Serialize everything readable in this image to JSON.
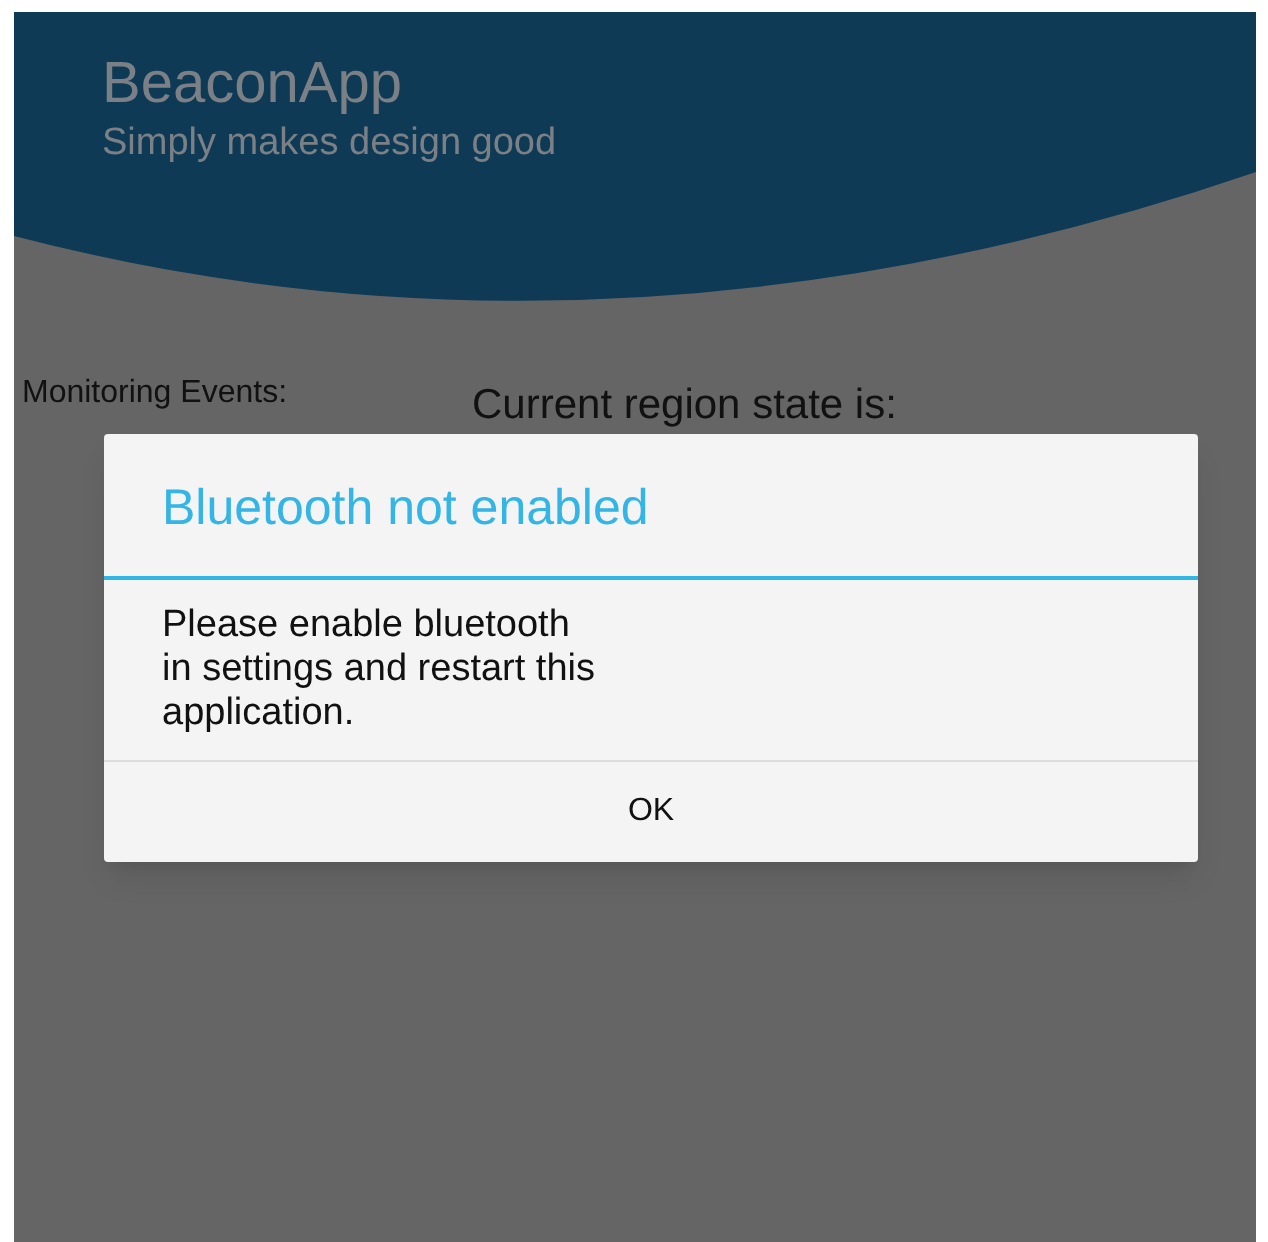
{
  "app_header": {
    "title": "BeaconApp",
    "subtitle": "Simply makes design good"
  },
  "content": {
    "monitoring_label": "Monitoring Events:",
    "region_state_label": "Current region state is:"
  },
  "dialog": {
    "title": "Bluetooth not enabled",
    "message": "Please enable bluetooth\nin settings and restart this\napplication.",
    "buttons": [
      "OK"
    ]
  }
}
